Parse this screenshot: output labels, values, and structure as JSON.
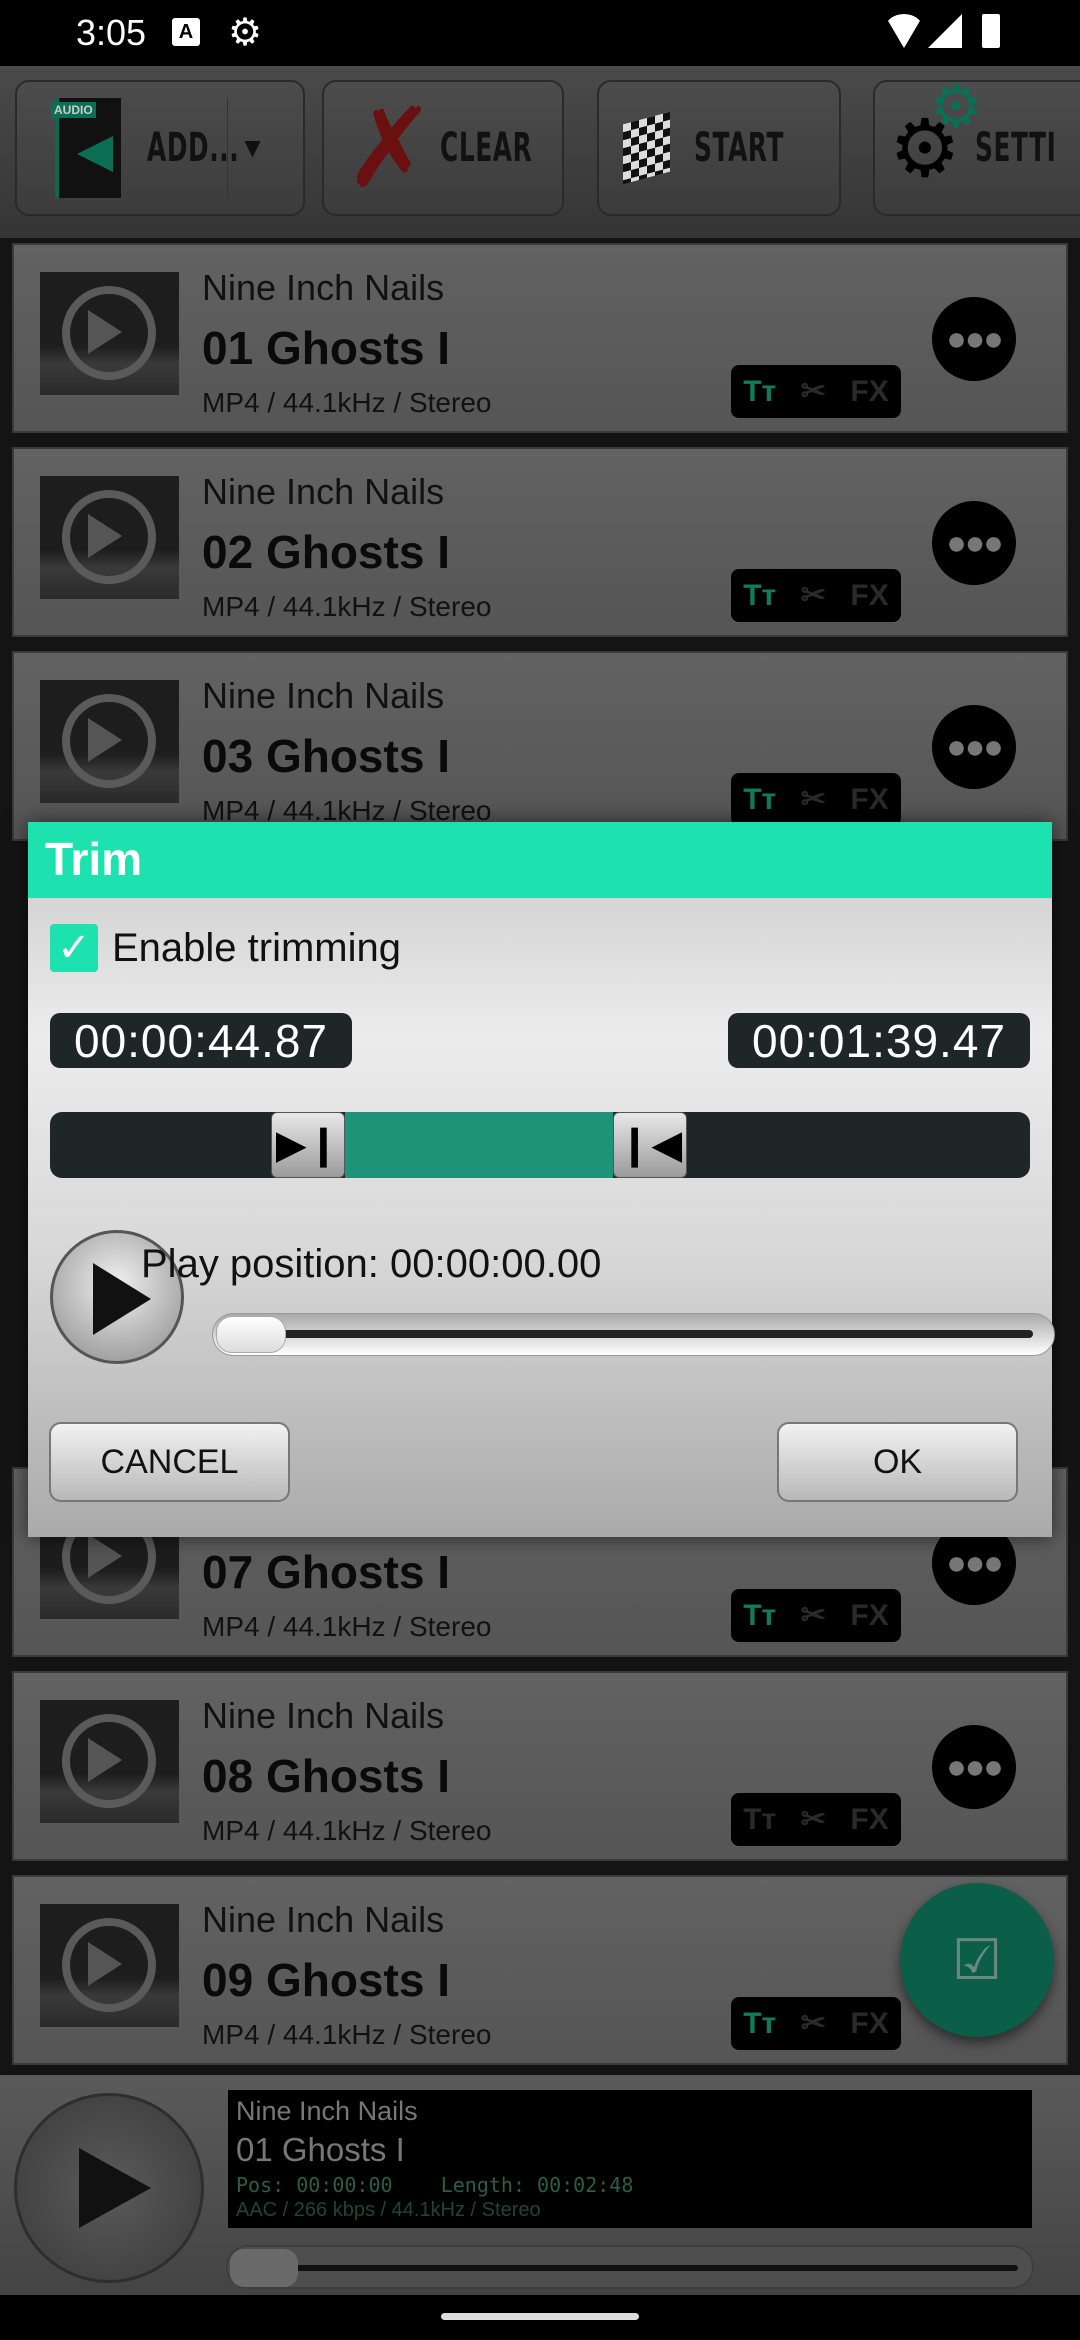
{
  "status_bar": {
    "time": "3:05",
    "icons": [
      "a-icon",
      "gear-icon",
      "wifi-icon",
      "signal-icon",
      "battery-icon"
    ]
  },
  "toolbar": {
    "add_label": "ADD...",
    "clear_label": "CLEAR",
    "start_label": "START",
    "settings_label": "SETTI"
  },
  "tracks": [
    {
      "artist": "Nine Inch Nails",
      "title": "01 Ghosts I",
      "format": "MP4 / 44.1kHz / Stereo",
      "text_badge_active": true
    },
    {
      "artist": "Nine Inch Nails",
      "title": "02 Ghosts I",
      "format": "MP4 / 44.1kHz / Stereo",
      "text_badge_active": true
    },
    {
      "artist": "Nine Inch Nails",
      "title": "03 Ghosts I",
      "format": "MP4 / 44.1kHz / Stereo",
      "text_badge_active": true
    },
    {
      "artist": "",
      "title": "07 Ghosts I",
      "format": "MP4 / 44.1kHz / Stereo",
      "text_badge_active": true
    },
    {
      "artist": "Nine Inch Nails",
      "title": "08 Ghosts I",
      "format": "MP4 / 44.1kHz / Stereo",
      "text_badge_active": false
    },
    {
      "artist": "Nine Inch Nails",
      "title": "09 Ghosts I",
      "format": "MP4 / 44.1kHz / Stereo",
      "text_badge_active": true
    }
  ],
  "badges": {
    "text": "Tт",
    "trim": "✂",
    "fx": "FX"
  },
  "dialog": {
    "title": "Trim",
    "enable_label": "Enable trimming",
    "enabled": true,
    "start_time": "00:00:44.87",
    "end_time": "00:01:39.47",
    "play_position_label": "Play position: 00:00:00.00",
    "cancel_label": "CANCEL",
    "ok_label": "OK"
  },
  "player": {
    "artist": "Nine Inch Nails",
    "title": "01 Ghosts I",
    "position_line": "Pos: 00:00:00    Length: 00:02:48",
    "format": "AAC / 266 kbps / 44.1kHz / Stereo",
    "progress": 0
  },
  "colors": {
    "accent": "#1de2b0",
    "selection": "#1e9377",
    "fab": "#0b5e47"
  }
}
